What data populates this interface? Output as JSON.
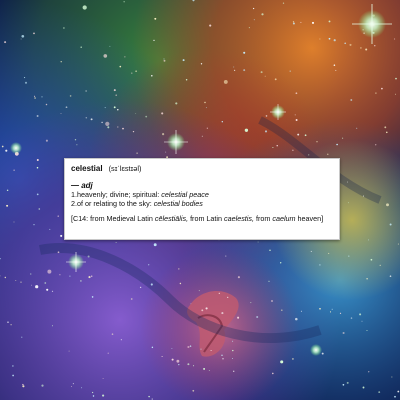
{
  "entry": {
    "headword": "celestial",
    "pronunciation": "(sɪˈlɛstɪəl)",
    "part_of_speech": "— adj",
    "senses": [
      {
        "label": "1.heavenly; divine; spiritual:",
        "example": "celestial peace"
      },
      {
        "label": "2.of or relating to the sky:",
        "example": "celestial bodies"
      }
    ],
    "etymology": {
      "prefix": "[C14: from Medieval Latin",
      "medieval_form": "cēlestiālis,",
      "latin_text": "from Latin",
      "latin_form": "caelestis,",
      "from_text": "from",
      "caelum": "caelum",
      "suffix": "heaven]"
    }
  },
  "background": {
    "theme": "nebula starfield",
    "colors": {
      "deep_blue": "#0b1f5a",
      "green": "#2f7d3a",
      "orange": "#d06a1d",
      "red": "#b3352c",
      "violet": "#6a3aa8",
      "cyan": "#39a5d8",
      "pink_cloud": "#c25a7a"
    }
  }
}
